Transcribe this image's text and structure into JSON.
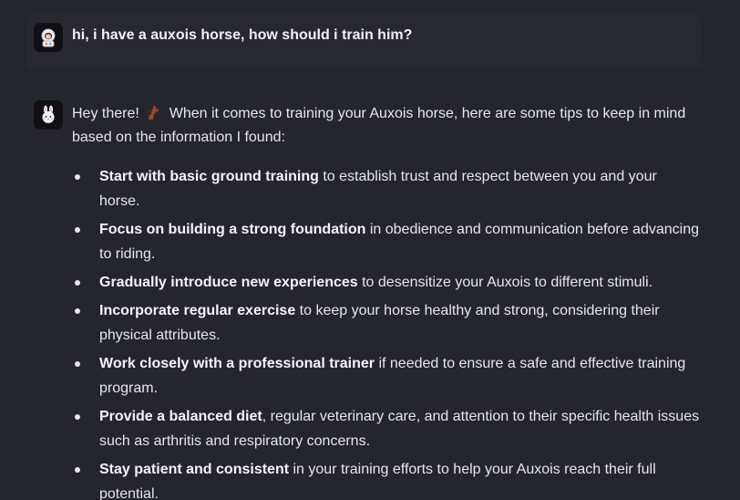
{
  "conversation": {
    "user_message": {
      "avatar_icon": "astronaut-avatar-icon",
      "text": "hi, i have a auxois horse, how should i train him?"
    },
    "assistant_message": {
      "avatar_icon": "bunny-avatar-icon",
      "intro_before_emoji": "Hey there!",
      "emoji_icon": "horse-icon",
      "intro_after_emoji": "When it comes to training your Auxois horse, here are some tips to keep in mind based on the information I found:",
      "tips": [
        {
          "bold": "Start with basic ground training",
          "rest": " to establish trust and respect between you and your horse."
        },
        {
          "bold": "Focus on building a strong foundation",
          "rest": " in obedience and communication before advancing to riding."
        },
        {
          "bold": "Gradually introduce new experiences",
          "rest": " to desensitize your Auxois to different stimuli."
        },
        {
          "bold": "Incorporate regular exercise",
          "rest": " to keep your horse healthy and strong, considering their physical attributes."
        },
        {
          "bold": "Work closely with a professional trainer",
          "rest": " if needed to ensure a safe and effective training program."
        },
        {
          "bold": "Provide a balanced diet",
          "rest": ", regular veterinary care, and attention to their specific health issues such as arthritis and respiratory concerns."
        },
        {
          "bold": "Stay patient and consistent",
          "rest": " in your training efforts to help your Auxois reach their full potential."
        }
      ]
    }
  },
  "colors": {
    "background": "#25252e",
    "user_bubble": "#282831",
    "avatar_bg": "#0f0f14",
    "text": "#e6e6ec"
  }
}
